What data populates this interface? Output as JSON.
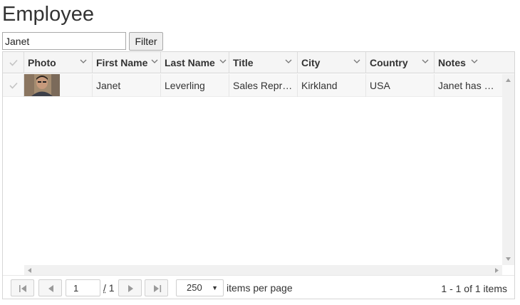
{
  "page": {
    "title": "Employee"
  },
  "filter": {
    "value": "Janet",
    "button_label": "Filter"
  },
  "grid": {
    "columns": [
      {
        "key": "photo",
        "label": "Photo"
      },
      {
        "key": "first_name",
        "label": "First Name"
      },
      {
        "key": "last_name",
        "label": "Last Name"
      },
      {
        "key": "title",
        "label": "Title"
      },
      {
        "key": "city",
        "label": "City"
      },
      {
        "key": "country",
        "label": "Country"
      },
      {
        "key": "notes",
        "label": "Notes"
      }
    ],
    "rows": [
      {
        "first_name": "Janet",
        "last_name": "Leverling",
        "title": "Sales Repr…",
        "city": "Kirkland",
        "country": "USA",
        "notes": "Janet has …"
      }
    ]
  },
  "pager": {
    "current_page": "1",
    "total_pages": "1",
    "page_size": "250",
    "items_per_page_label": "items per page",
    "summary": "1 - 1 of 1 items"
  },
  "colors": {
    "header_bg": "#f5f5f5",
    "border": "#d6d6d6",
    "row_bg": "#f7f7f7"
  }
}
